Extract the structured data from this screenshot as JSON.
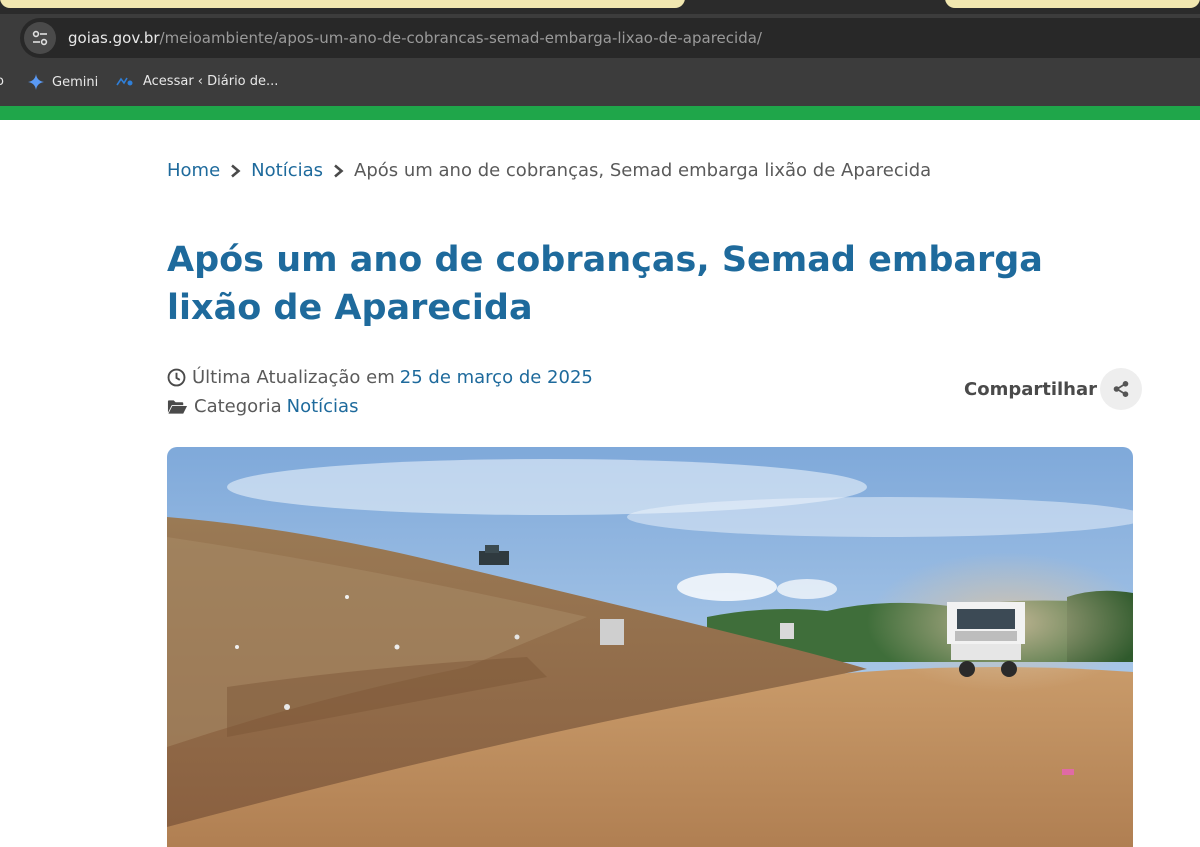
{
  "browser": {
    "url_host": "goias.gov.br",
    "url_path": "/meioambiente/apos-um-ano-de-cobrancas-semad-embarga-lixao-de-aparecida/",
    "bookmarks": [
      {
        "label": "Gemini",
        "icon": "gemini-sparkle-icon"
      },
      {
        "label": "Acessar ‹ Diário de...",
        "icon": "diario-favicon-icon"
      }
    ]
  },
  "breadcrumb": {
    "home": "Home",
    "news": "Notícias",
    "current": "Após um ano de cobranças, Semad embarga lixão de Aparecida"
  },
  "article": {
    "title": "Após um ano de cobranças, Semad embarga lixão de Aparecida",
    "updated_label": "Última Atualização em",
    "updated_date": "25 de março de 2025",
    "category_label": "Categoria",
    "category_value": "Notícias",
    "share_label": "Compartilhar"
  },
  "colors": {
    "link_blue": "#1e6a9c",
    "header_green": "#1fa64a",
    "browser_dark": "#3c3c3c"
  }
}
